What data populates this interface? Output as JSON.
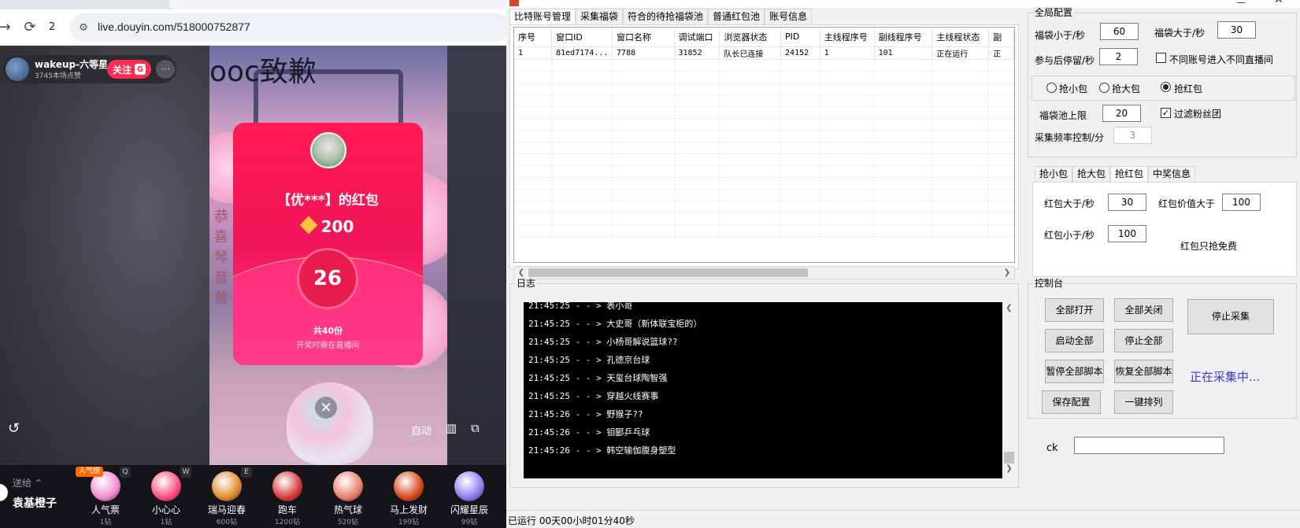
{
  "browser": {
    "tab_count": "2",
    "url": "live.douyin.com/518000752877",
    "stream": {
      "streamer_name": "wakeup-六等星",
      "streamer_sub": "3745本场点赞",
      "follow_label": "关注",
      "follow_badge": "G",
      "more_label": "···",
      "video_text": "ooc致歉",
      "side_words": "恭喜琴音曾",
      "redpacket": {
        "title": "【优***】的红包",
        "amount": "200",
        "countdown": "26",
        "total": "共40份",
        "note": "开奖时需在直播间"
      },
      "auto_label": "自动",
      "send_to": "送给",
      "receiver": "袁基橙子",
      "gifts": [
        {
          "name": "人气票",
          "price": "1钻",
          "key": "Q",
          "badge": "人气榜",
          "color": "#f08ad1"
        },
        {
          "name": "小心心",
          "price": "1钻",
          "key": "W",
          "badge": "",
          "color": "#ff4d7d"
        },
        {
          "name": "瑞马迎春",
          "price": "600钻",
          "key": "E",
          "badge": "",
          "color": "#e08a2a"
        },
        {
          "name": "跑车",
          "price": "1200钻",
          "key": "",
          "badge": "",
          "color": "#d93a3a"
        },
        {
          "name": "热气球",
          "price": "520钻",
          "key": "",
          "badge": "",
          "color": "#e77f6a"
        },
        {
          "name": "马上发财",
          "price": "199钻",
          "key": "",
          "badge": "",
          "color": "#d8471c"
        },
        {
          "name": "闪耀星辰",
          "price": "99钻",
          "key": "",
          "badge": "",
          "color": "#8a7cf0"
        }
      ]
    }
  },
  "app": {
    "tabs": [
      "比特账号管理",
      "采集福袋",
      "符合的待抢福袋池",
      "普通红包池",
      "账号信息"
    ],
    "table": {
      "headers": [
        "序号",
        "窗口ID",
        "窗口名称",
        "调试端口",
        "浏览器状态",
        "PID",
        "主线程序号",
        "副线程序号",
        "主线程状态",
        "副"
      ],
      "rows": [
        [
          "1",
          "81ed7174...",
          "7788",
          "31852",
          "队长已连接",
          "24152",
          "1",
          "101",
          "正在运行",
          "正"
        ]
      ]
    },
    "log": {
      "title": "日志",
      "lines": [
        "21:45:25 - - > 表小哥",
        "21:45:25 - - > 大史哥（新体联宝柜的）",
        "21:45:25 - - > 小杨哥解说篮球??",
        "21:45:25 - - > 孔德京台球",
        "21:45:25 - - > 天玺台球陶智强",
        "21:45:25 - - > 穿越火线赛事",
        "21:45:26 - - > 野猴子??",
        "21:45:26 - - > 钼郾乒乓球",
        "21:45:26 - - > 韩空输伽腹身塑型"
      ]
    },
    "global_config": {
      "title": "全局配置",
      "bag_less_label": "福袋小于/秒",
      "bag_less_value": "60",
      "bag_more_label": "福袋大于/秒",
      "bag_more_value": "30",
      "stay_label": "参与后停留/秒",
      "stay_value": "2",
      "diff_room_label": "不同账号进入不同直播间",
      "diff_room_checked": false,
      "mode_options": [
        "抢小包",
        "抢大包",
        "抢红包"
      ],
      "mode_selected": 2,
      "pool_limit_label": "福袋池上限",
      "pool_limit_value": "20",
      "filter_fans_label": "过滤粉丝团",
      "filter_fans_checked": true,
      "collect_freq_label": "采集频率控制/分",
      "collect_freq_value": "3"
    },
    "sub_tabs": [
      "抢小包",
      "抢大包",
      "抢红包",
      "中奖信息"
    ],
    "redpacket_config": {
      "more_label": "红包大于/秒",
      "more_value": "30",
      "value_more_label": "红包价值大于",
      "value_more_value": "100",
      "less_label": "红包小于/秒",
      "less_value": "100",
      "free_only_label": "红包只抢免费"
    },
    "console": {
      "title": "控制台",
      "open_all": "全部打开",
      "close_all": "全部关闭",
      "stop_collect": "停止采集",
      "start_all": "启动全部",
      "stop_all": "停止全部",
      "pause_scripts": "暂停全部脚本",
      "resume_scripts": "恢复全部脚本",
      "status": "正在采集中...",
      "save_config": "保存配置",
      "arrange": "一键排列"
    },
    "ck_label": "ck",
    "ck_value": "",
    "status_bar": "已运行  00天00小时01分40秒"
  }
}
